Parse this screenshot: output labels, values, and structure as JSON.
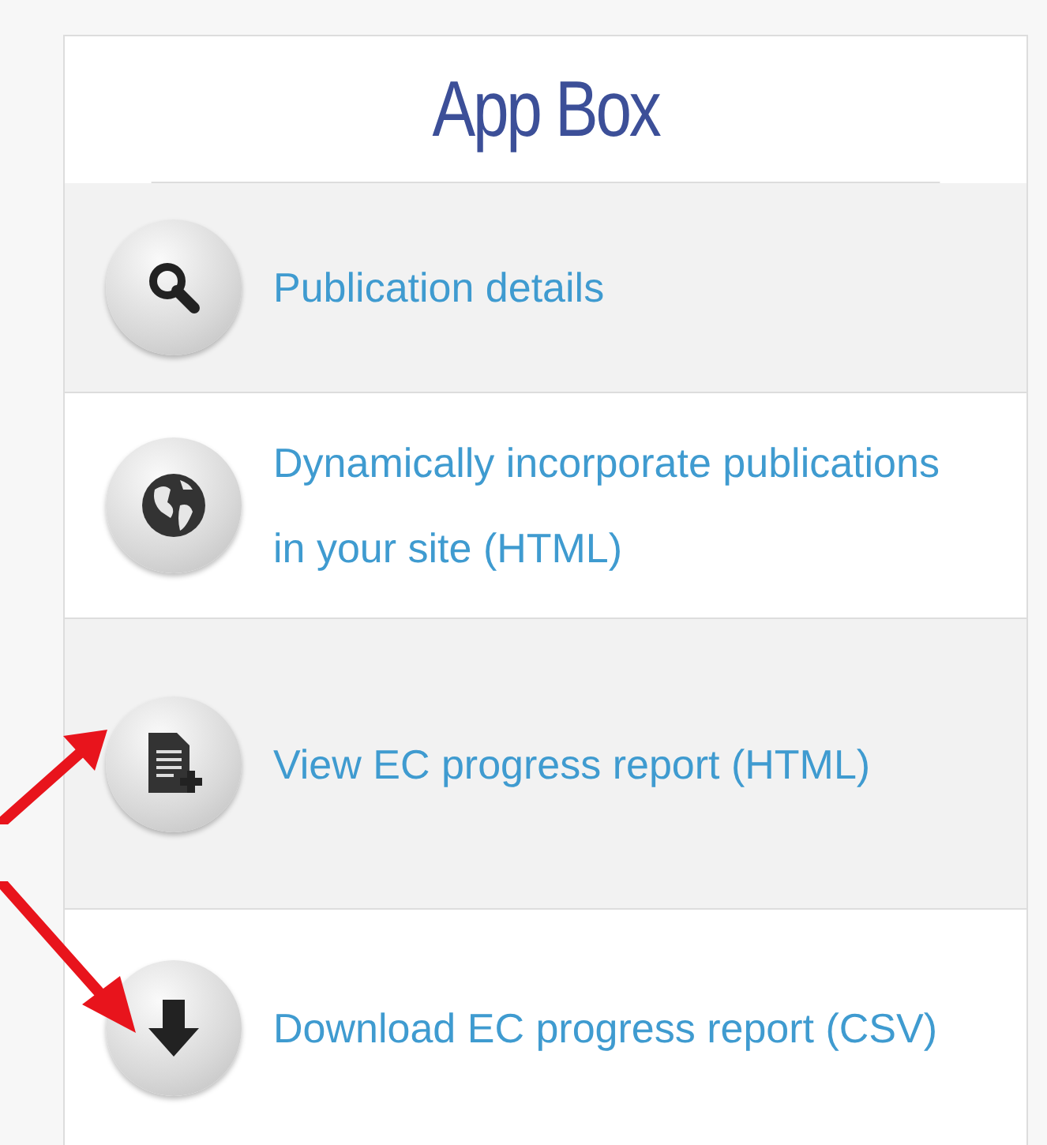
{
  "panel": {
    "title": "App Box",
    "rows": [
      {
        "kind": "search",
        "label": "Publication details",
        "highlighted": false
      },
      {
        "kind": "globe",
        "label": "Dynamically incorporate publications in your site (HTML)",
        "highlighted": false
      },
      {
        "kind": "document-add",
        "label": "View EC progress report (HTML)",
        "highlighted": true
      },
      {
        "kind": "download",
        "label": "Download EC progress report (CSV)",
        "highlighted": true
      }
    ]
  }
}
